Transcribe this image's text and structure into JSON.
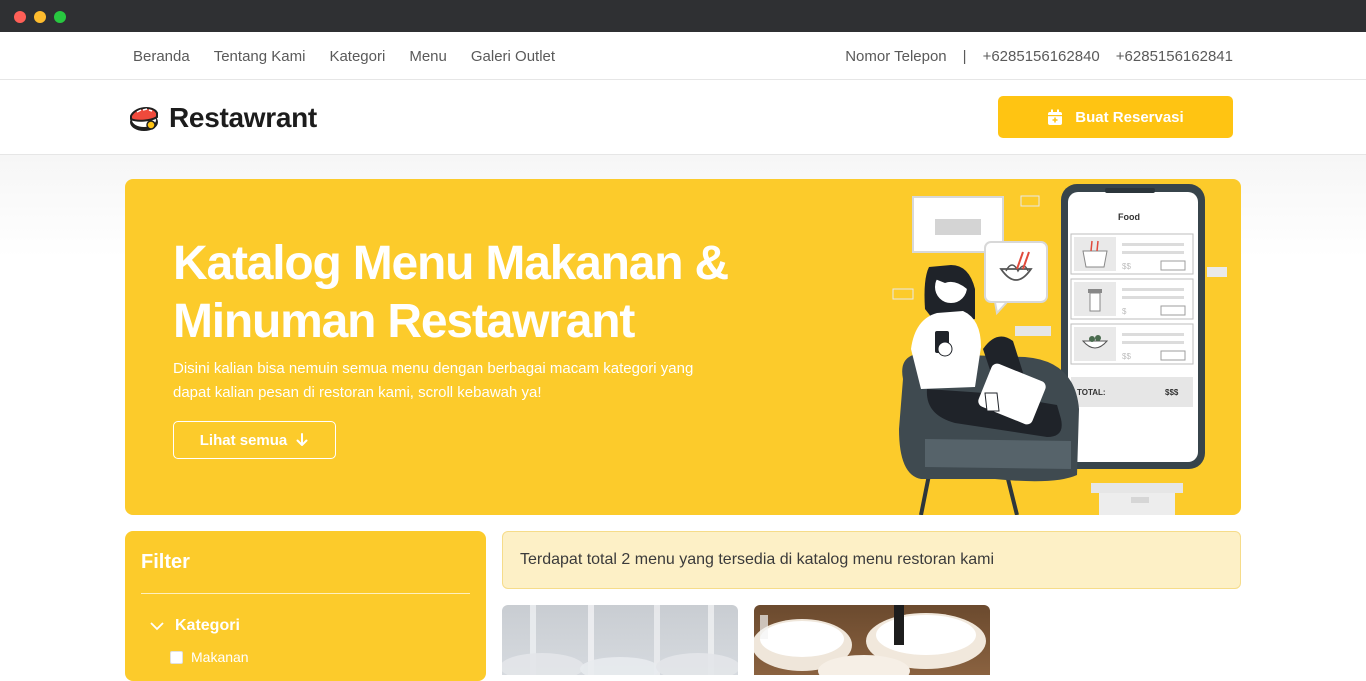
{
  "topnav": {
    "links": [
      "Beranda",
      "Tentang Kami",
      "Kategori",
      "Menu",
      "Galeri Outlet"
    ],
    "phone_label": "Nomor Telepon",
    "separator": "|",
    "phones": [
      "+6285156162840",
      "+6285156162841"
    ]
  },
  "header": {
    "brand": "Restawrant",
    "reserve_label": "Buat Reservasi"
  },
  "hero": {
    "title": "Katalog Menu Makanan & Minuman Restawrant",
    "subtitle": "Disini kalian bisa nemuin semua menu dengan berbagai macam kategori yang dapat kalian pesan di restoran kami, scroll kebawah ya!",
    "cta": "Lihat semua",
    "phone_screen": {
      "heading": "Food",
      "price_placeholder": "$$",
      "price_placeholder_alt": "$",
      "total_label": "TOTAL:",
      "total_value": "$$$"
    }
  },
  "filter": {
    "title": "Filter",
    "category_label": "Kategori",
    "options": [
      "Makanan"
    ]
  },
  "results": {
    "summary": "Terdapat total 2 menu yang tersedia di katalog menu restoran kami"
  },
  "colors": {
    "accent": "#fccb2b",
    "button": "#ffc412",
    "info_bg": "#fdf0c6"
  }
}
